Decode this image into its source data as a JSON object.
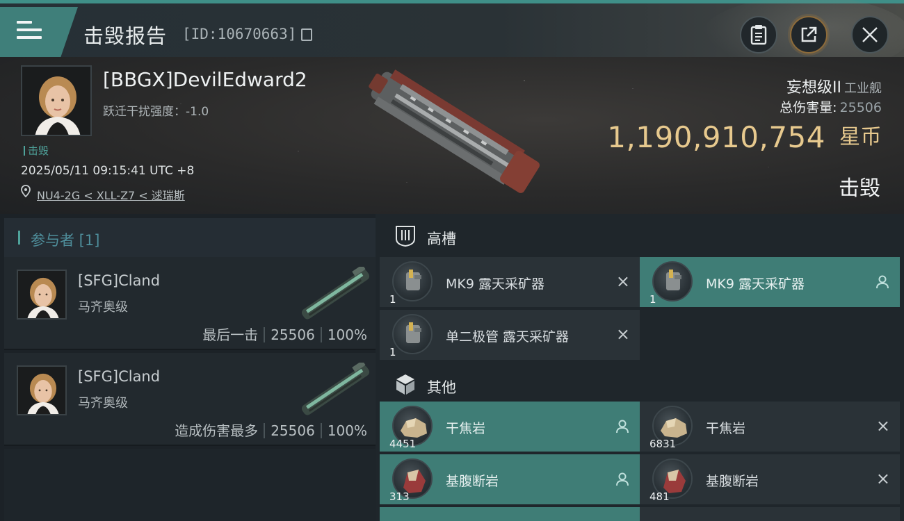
{
  "header": {
    "title": "击毁报告",
    "report_id": "[ID:10670663]"
  },
  "victim": {
    "name": "[BBGX]DevilEdward2",
    "warp_disruption": "跃迁干扰强度：-1.0",
    "status_small": "击毁",
    "timestamp": "2025/05/11 09:15:41 UTC +8",
    "location": "NU4-2G < XLL-Z7 < 逑瑞斯",
    "ship_class": "妄想级II",
    "ship_category": "工业舰",
    "total_damage_label": "总伤害量:",
    "total_damage": "25506",
    "isk_value": "1,190,910,754",
    "isk_unit": "星币",
    "result": "击毁"
  },
  "participants": {
    "title": "参与者 [1]",
    "list": [
      {
        "name": "[SFG]Cland",
        "ship": "马齐奥级",
        "role": "最后一击",
        "damage": "25506",
        "percent": "100%"
      },
      {
        "name": "[SFG]Cland",
        "ship": "马齐奥级",
        "role": "造成伤害最多",
        "damage": "25506",
        "percent": "100%"
      }
    ]
  },
  "high_slots": {
    "title": "高槽",
    "items": [
      {
        "name": "MK9 露天采矿器",
        "qty": "1",
        "status": "destroyed"
      },
      {
        "name": "MK9 露天采矿器",
        "qty": "1",
        "status": "dropped"
      },
      {
        "name": "单二极管 露天采矿器",
        "qty": "1",
        "status": "destroyed"
      }
    ]
  },
  "other": {
    "title": "其他",
    "items": [
      {
        "name": "干焦岩",
        "qty": "4451",
        "status": "dropped"
      },
      {
        "name": "干焦岩",
        "qty": "6831",
        "status": "destroyed"
      },
      {
        "name": "基腹断岩",
        "qty": "313",
        "status": "dropped"
      },
      {
        "name": "基腹断岩",
        "qty": "481",
        "status": "destroyed"
      }
    ]
  },
  "icons": {
    "destroyed_mark": "×",
    "menu": "menu-icon",
    "clipboard": "clipboard-icon",
    "share": "share-icon",
    "close": "close-icon",
    "location": "location-pin-icon",
    "person": "person-icon"
  },
  "colors": {
    "accent_teal": "#3f7d76",
    "isk_gold": "#e7c98e",
    "panel_dark": "#22292e"
  }
}
